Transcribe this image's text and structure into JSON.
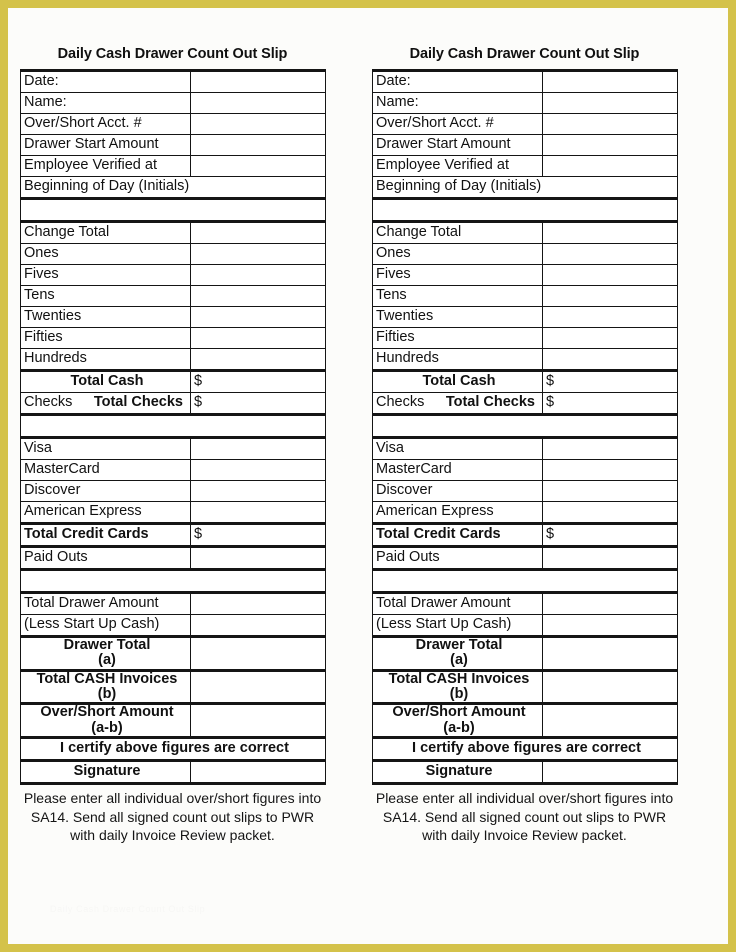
{
  "document": {
    "title": "Daily Cash Drawer Count Out Slip",
    "watermark": "Daily Cash Drawer Count Out Slip"
  },
  "slip": {
    "title": "Daily Cash Drawer Count Out Slip",
    "header_rows": [
      {
        "label": "Date:",
        "value": ""
      },
      {
        "label": "Name:",
        "value": ""
      },
      {
        "label": "Over/Short Acct. #",
        "value": ""
      },
      {
        "label": "Drawer Start Amount",
        "value": ""
      },
      {
        "label": "Employee Verified at",
        "value": ""
      }
    ],
    "initials_row": "Beginning of Day (Initials)",
    "denomination_rows": [
      {
        "label": "Change Total",
        "value": ""
      },
      {
        "label": "Ones",
        "value": ""
      },
      {
        "label": "Fives",
        "value": ""
      },
      {
        "label": "Tens",
        "value": ""
      },
      {
        "label": "Twenties",
        "value": ""
      },
      {
        "label": "Fifties",
        "value": ""
      },
      {
        "label": "Hundreds",
        "value": ""
      }
    ],
    "total_cash": {
      "label": "Total Cash",
      "value": "$"
    },
    "total_checks": {
      "prefix": "Checks",
      "label": "Total Checks",
      "value": "$"
    },
    "card_rows": [
      {
        "label": "Visa",
        "value": ""
      },
      {
        "label": "MasterCard",
        "value": ""
      },
      {
        "label": "Discover",
        "value": ""
      },
      {
        "label": "American Express",
        "value": ""
      }
    ],
    "total_credit_cards": {
      "label": "Total Credit Cards",
      "value": "$"
    },
    "paid_outs": {
      "label": "Paid Outs",
      "value": ""
    },
    "drawer_rows": [
      {
        "label": "Total Drawer Amount",
        "value": ""
      },
      {
        "label": "(Less Start Up Cash)",
        "value": ""
      }
    ],
    "summary_rows": [
      {
        "line1": "Drawer Total",
        "line2": "(a)",
        "value": ""
      },
      {
        "line1": "Total CASH Invoices",
        "line2": "(b)",
        "value": ""
      },
      {
        "line1": "Over/Short Amount",
        "line2": "(a-b)",
        "value": ""
      }
    ],
    "certify": "I certify above figures are correct",
    "signature": {
      "label": "Signature",
      "value": ""
    },
    "footnote": "Please enter all individual over/short figures into SA14. Send all signed count out slips to PWR with daily Invoice Review packet."
  },
  "colors": {
    "page_border": "#d4c24a",
    "paper": "#fdfdfb",
    "ink": "#111111"
  }
}
